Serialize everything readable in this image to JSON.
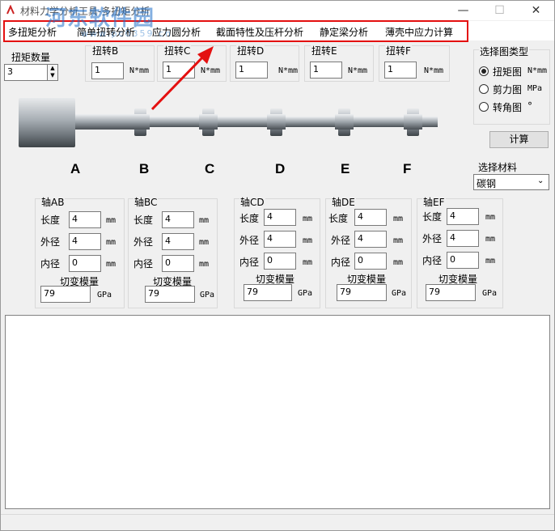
{
  "window": {
    "title": "材料力学分析工具-多扭矩分析",
    "minimize_icon": "minimize-icon",
    "maximize_icon": "maximize-icon",
    "close_icon": "close-icon"
  },
  "watermark": {
    "text": "河东软件园",
    "url": "www.pc0359.cn"
  },
  "menu": {
    "items": [
      {
        "label": "多扭矩分析"
      },
      {
        "label": "简单扭转分析"
      },
      {
        "label": "应力圆分析"
      },
      {
        "label": "截面特性及压杆分析"
      },
      {
        "label": "静定梁分析"
      },
      {
        "label": "薄壳中应力计算"
      }
    ],
    "highlight_color": "#e41010"
  },
  "torque_count": {
    "label": "扭矩数量",
    "value": "3"
  },
  "torques": [
    {
      "label": "扭转B",
      "value": "1",
      "unit": "N*mm"
    },
    {
      "label": "扭转C",
      "value": "1",
      "unit": "N*mm"
    },
    {
      "label": "扭转D",
      "value": "1",
      "unit": "N*mm"
    },
    {
      "label": "扭转E",
      "value": "1",
      "unit": "N*mm"
    },
    {
      "label": "扭转F",
      "value": "1",
      "unit": "N*mm"
    }
  ],
  "points": [
    "A",
    "B",
    "C",
    "D",
    "E",
    "F"
  ],
  "chart_type": {
    "label": "选择图类型",
    "options": [
      {
        "label": "扭矩图",
        "unit": "N*mm",
        "selected": true
      },
      {
        "label": "剪力图",
        "unit": "MPa",
        "selected": false
      },
      {
        "label": "转角图",
        "unit": "°",
        "selected": false
      }
    ]
  },
  "calc_button": "计算",
  "material": {
    "label": "选择材料",
    "value": "碳钢"
  },
  "shafts": [
    {
      "title": "轴AB",
      "length_label": "长度",
      "length": "4",
      "outer_label": "外径",
      "outer": "4",
      "inner_label": "内径",
      "inner": "0",
      "mm": "mm",
      "modulus_label": "切变模量",
      "modulus": "79",
      "modulus_unit": "GPa"
    },
    {
      "title": "轴BC",
      "length_label": "长度",
      "length": "4",
      "outer_label": "外径",
      "outer": "4",
      "inner_label": "内径",
      "inner": "0",
      "mm": "mm",
      "modulus_label": "切变模量",
      "modulus": "79",
      "modulus_unit": "GPa"
    },
    {
      "title": "轴CD",
      "length_label": "长度",
      "length": "4",
      "outer_label": "外径",
      "outer": "4",
      "inner_label": "内径",
      "inner": "0",
      "mm": "mm",
      "modulus_label": "切变模量",
      "modulus": "79",
      "modulus_unit": "GPa"
    },
    {
      "title": "轴DE",
      "length_label": "长度",
      "length": "4",
      "outer_label": "外径",
      "outer": "4",
      "inner_label": "内径",
      "inner": "0",
      "mm": "mm",
      "modulus_label": "切变模量",
      "modulus": "79",
      "modulus_unit": "GPa"
    },
    {
      "title": "轴EF",
      "length_label": "长度",
      "length": "4",
      "outer_label": "外径",
      "outer": "4",
      "inner_label": "内径",
      "inner": "0",
      "mm": "mm",
      "modulus_label": "切变模量",
      "modulus": "79",
      "modulus_unit": "GPa"
    }
  ],
  "annotation_arrow_color": "#e41010"
}
